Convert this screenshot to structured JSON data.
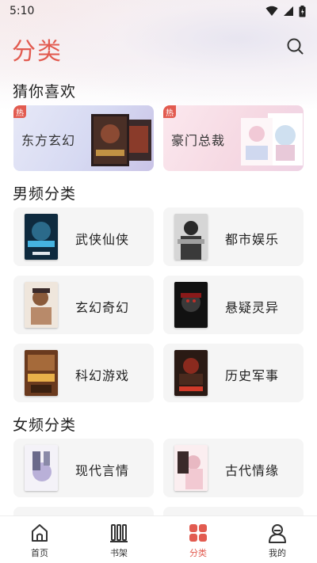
{
  "status": {
    "time": "5:10"
  },
  "header": {
    "title": "分类"
  },
  "sections": {
    "guess": "猜你喜欢",
    "male": "男频分类",
    "female": "女频分类"
  },
  "recommend": [
    {
      "label": "东方玄幻",
      "badge": "热"
    },
    {
      "label": "豪门总裁",
      "badge": "热"
    }
  ],
  "male_categories": [
    "武侠仙侠",
    "都市娱乐",
    "玄幻奇幻",
    "悬疑灵异",
    "科幻游戏",
    "历史军事"
  ],
  "female_categories": [
    "现代言情",
    "古代情缘"
  ],
  "tabbar": [
    {
      "label": "首页",
      "icon": "home-icon"
    },
    {
      "label": "书架",
      "icon": "bookshelf-icon"
    },
    {
      "label": "分类",
      "icon": "category-grid-icon",
      "active": true
    },
    {
      "label": "我的",
      "icon": "profile-icon"
    }
  ],
  "colors": {
    "accent": "#e25b50",
    "card_bg": "#f5f5f5"
  }
}
